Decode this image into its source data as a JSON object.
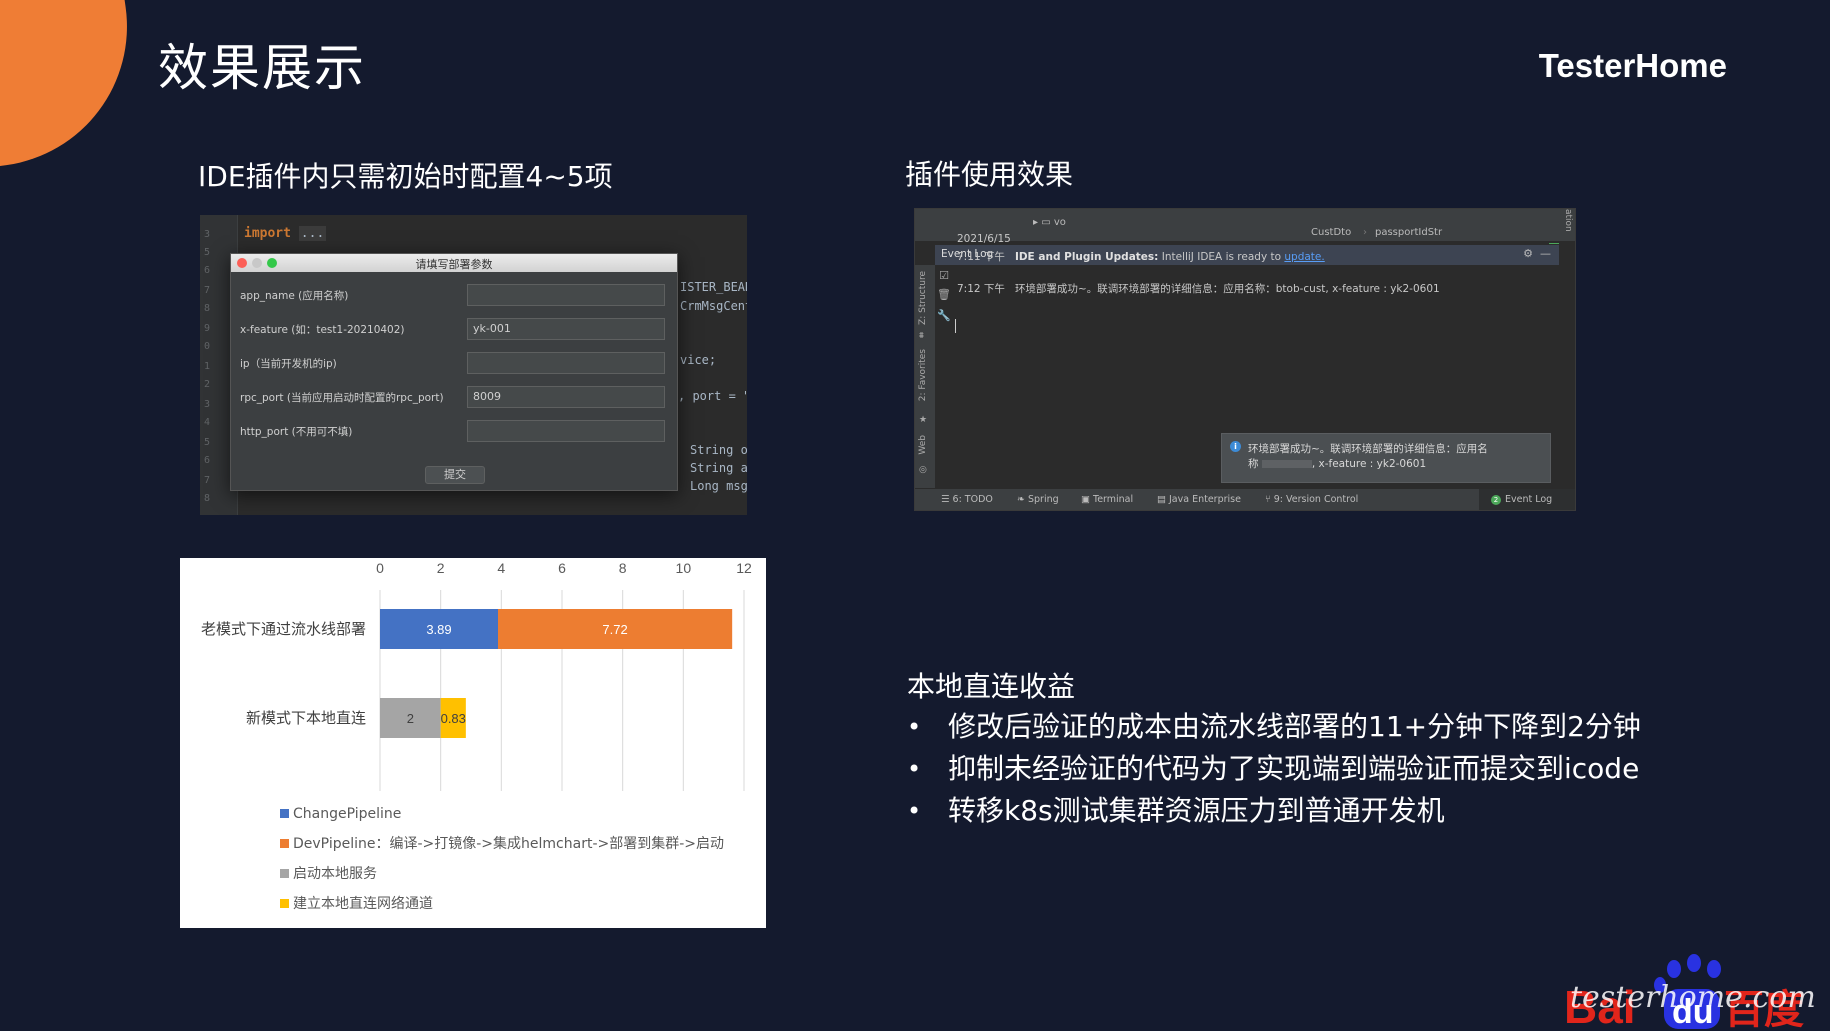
{
  "slide": {
    "title": "效果展示",
    "brand": "TesterHome"
  },
  "left_section": {
    "title": "IDE插件内只需初始时配置4~5项"
  },
  "right_section": {
    "title": "插件使用效果"
  },
  "ide": {
    "code_import": "import",
    "code_import_fold": "...",
    "code_fragments": [
      "ISTER_BEAN",
      "CrmMsgCent",
      "vice;",
      ", port = \"",
      "String o",
      "String a",
      "Long msg"
    ],
    "dialog_title": "请填写部署参数",
    "fields": [
      {
        "label": "app_name (应用名称)",
        "value": ""
      },
      {
        "label": "x-feature (如：test1-20210402)",
        "value": "yk-001"
      },
      {
        "label": "ip（当前开发机的ip)",
        "value": ""
      },
      {
        "label": "rpc_port (当前应用启动时配置的rpc_port)",
        "value": "8009"
      },
      {
        "label": "http_port (不用可不填)",
        "value": ""
      }
    ],
    "submit_label": "提交"
  },
  "eventlog": {
    "tree_item": "vo",
    "crumbs": [
      "CustDto",
      "passportIdStr"
    ],
    "side_label": "ation",
    "panel_title": "Event Log",
    "left_tabs": [
      "Z: Structure",
      "2: Favorites",
      "Web"
    ],
    "date": "2021/6/15",
    "line1_time": "7:11 下午",
    "line1_bold": "IDE and Plugin Updates:",
    "line1_text": "IntelliJ IDEA is ready to",
    "line1_link": "update.",
    "line2_time": "7:12 下午",
    "line2_text": "环境部署成功~。联调环境部署的详细信息：应用名称：btob-cust, x-feature : yk2-0601",
    "notify_line1": "环境部署成功~。联调环境部署的详细信息：应用名",
    "notify_line2_prefix": "称",
    "notify_line2": ", x-feature : yk2-0601",
    "bottom_tabs": [
      "6: TODO",
      "Spring",
      "Terminal",
      "Java Enterprise",
      "9: Version Control"
    ],
    "active_tab": "Event Log",
    "active_badge": "2"
  },
  "chart_data": {
    "type": "bar",
    "orientation": "horizontal",
    "stacked": true,
    "categories": [
      "老模式下通过流水线部署",
      "新模式下本地直连"
    ],
    "series": [
      {
        "name": "ChangePipeline",
        "color": "#4472c4",
        "values": [
          3.89,
          null
        ]
      },
      {
        "name": "DevPipeline：编译->打镜像->集成helmchart->部署到集群->启动",
        "color": "#ed7d31",
        "values": [
          7.72,
          null
        ]
      },
      {
        "name": "启动本地服务",
        "color": "#a5a5a5",
        "values": [
          null,
          2
        ]
      },
      {
        "name": "建立本地直连网络通道",
        "color": "#ffc000",
        "values": [
          null,
          0.83
        ]
      }
    ],
    "data_labels": [
      [
        "3.89",
        "7.72"
      ],
      [
        "2",
        "0.83"
      ]
    ],
    "xlim": [
      0,
      12
    ],
    "xticks": [
      "0",
      "2",
      "4",
      "6",
      "8",
      "10",
      "12"
    ],
    "axis_position": "top",
    "grid": true,
    "legend_position": "bottom"
  },
  "benefits": {
    "title": "本地直连收益",
    "items": [
      "修改后验证的成本由流水线部署的11+分钟下降到2分钟",
      "抑制未经验证的代码为了实现端到端验证而提交到icode",
      "转移k8s测试集群资源压力到普通开发机"
    ]
  },
  "logo": {
    "text_bai": "Bai",
    "text_du": "du",
    "text_cn": "百度",
    "watermark": "testerhome.com"
  },
  "colors": {
    "background": "#141a2e",
    "accent": "#ef7d35",
    "baidu_red": "#e1251b",
    "baidu_blue": "#2932e1"
  }
}
